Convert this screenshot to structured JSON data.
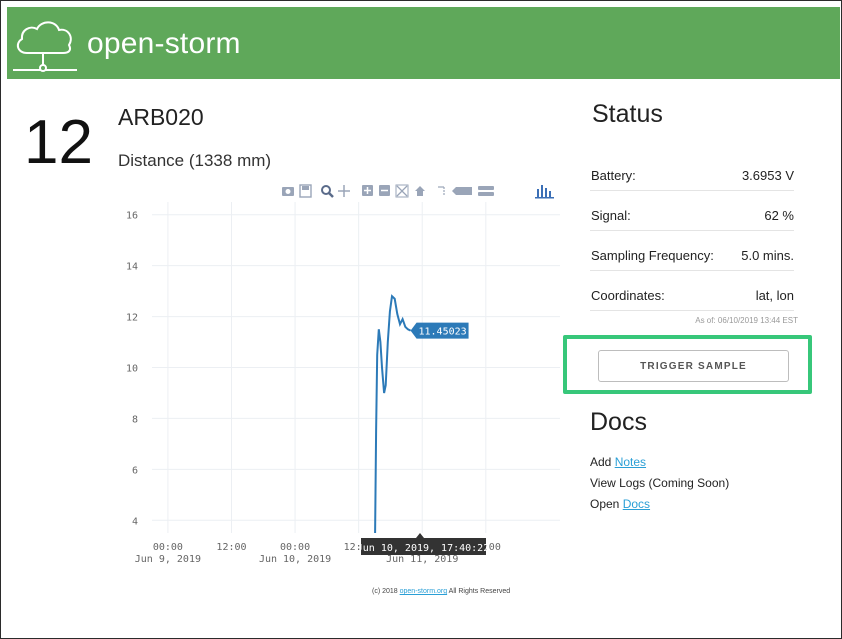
{
  "header": {
    "brand": "open-storm"
  },
  "site": {
    "number": "12",
    "name": "ARB020",
    "metric_label": "Distance (1338 mm)"
  },
  "chart_data": {
    "type": "line",
    "title": "",
    "xlabel": "",
    "ylabel": "",
    "ylim": [
      3.5,
      16.5
    ],
    "yticks": [
      4,
      6,
      8,
      10,
      12,
      14,
      16
    ],
    "xticks": [
      {
        "line1": "00:00",
        "line2": "Jun 9, 2019"
      },
      {
        "line1": "12:00",
        "line2": ""
      },
      {
        "line1": "00:00",
        "line2": "Jun 10, 2019"
      },
      {
        "line1": "12:00",
        "line2": ""
      },
      {
        "line1": "00:00",
        "line2": "Jun 11, 2019"
      },
      {
        "line1": "12:00",
        "line2": ""
      }
    ],
    "x_unit": "hours since Jun 9, 2019 00:00",
    "grid": true,
    "series": [
      {
        "name": "",
        "color": "#2c7ab8",
        "points": [
          [
            39.1,
            3.5
          ],
          [
            39.3,
            7.5
          ],
          [
            39.5,
            10.5
          ],
          [
            39.8,
            11.5
          ],
          [
            40.1,
            11.0
          ],
          [
            40.4,
            10.0
          ],
          [
            40.8,
            9.0
          ],
          [
            41.1,
            9.3
          ],
          [
            41.5,
            11.0
          ],
          [
            41.9,
            12.2
          ],
          [
            42.3,
            12.8
          ],
          [
            42.8,
            12.7
          ],
          [
            43.3,
            12.1
          ],
          [
            43.8,
            11.7
          ],
          [
            44.3,
            11.9
          ],
          [
            44.8,
            11.6
          ],
          [
            45.3,
            11.5
          ],
          [
            45.8,
            11.45
          ]
        ]
      }
    ],
    "hover_value": "11.45023",
    "hover_time": "Jun 10, 2019, 17:40:22"
  },
  "status": {
    "title": "Status",
    "rows": [
      {
        "label": "Battery:",
        "value": "3.6953 V"
      },
      {
        "label": "Signal:",
        "value": "62 %"
      },
      {
        "label": "Sampling Frequency:",
        "value": "5.0 mins."
      },
      {
        "label": "Coordinates:",
        "value": "lat, lon"
      }
    ],
    "as_of": "As of: 06/10/2019 13:44 EST",
    "trigger_label": "TRIGGER SAMPLE"
  },
  "docs": {
    "title": "Docs",
    "add_prefix": "Add ",
    "add_link": "Notes",
    "view_logs": "View Logs (Coming Soon)",
    "open_prefix": "Open ",
    "open_link": "Docs"
  },
  "footer": {
    "prefix": "(c) 2018 ",
    "link": "open-storm.org",
    "suffix": " All Rights Reserved"
  },
  "colors": {
    "header": "#5fa85a",
    "highlight": "#37c77a",
    "link": "#2a9fd6",
    "line": "#2c7ab8"
  },
  "icons": [
    "cloud-network-icon",
    "camera-icon",
    "save-icon",
    "zoom-icon",
    "pan-icon",
    "zoom-in-icon",
    "zoom-out-icon",
    "autoscale-icon",
    "home-icon",
    "spike-lines-icon",
    "hover-closest-icon",
    "hover-compare-icon",
    "plotly-logo-icon"
  ]
}
